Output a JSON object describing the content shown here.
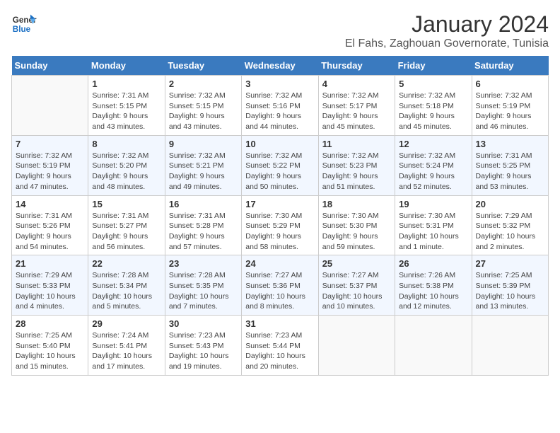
{
  "logo": {
    "text_general": "General",
    "text_blue": "Blue"
  },
  "title": "January 2024",
  "subtitle": "El Fahs, Zaghouan Governorate, Tunisia",
  "days_of_week": [
    "Sunday",
    "Monday",
    "Tuesday",
    "Wednesday",
    "Thursday",
    "Friday",
    "Saturday"
  ],
  "weeks": [
    [
      {
        "day": "",
        "sunrise": "",
        "sunset": "",
        "daylight": ""
      },
      {
        "day": "1",
        "sunrise": "Sunrise: 7:31 AM",
        "sunset": "Sunset: 5:15 PM",
        "daylight": "Daylight: 9 hours and 43 minutes."
      },
      {
        "day": "2",
        "sunrise": "Sunrise: 7:32 AM",
        "sunset": "Sunset: 5:15 PM",
        "daylight": "Daylight: 9 hours and 43 minutes."
      },
      {
        "day": "3",
        "sunrise": "Sunrise: 7:32 AM",
        "sunset": "Sunset: 5:16 PM",
        "daylight": "Daylight: 9 hours and 44 minutes."
      },
      {
        "day": "4",
        "sunrise": "Sunrise: 7:32 AM",
        "sunset": "Sunset: 5:17 PM",
        "daylight": "Daylight: 9 hours and 45 minutes."
      },
      {
        "day": "5",
        "sunrise": "Sunrise: 7:32 AM",
        "sunset": "Sunset: 5:18 PM",
        "daylight": "Daylight: 9 hours and 45 minutes."
      },
      {
        "day": "6",
        "sunrise": "Sunrise: 7:32 AM",
        "sunset": "Sunset: 5:19 PM",
        "daylight": "Daylight: 9 hours and 46 minutes."
      }
    ],
    [
      {
        "day": "7",
        "sunrise": "Sunrise: 7:32 AM",
        "sunset": "Sunset: 5:19 PM",
        "daylight": "Daylight: 9 hours and 47 minutes."
      },
      {
        "day": "8",
        "sunrise": "Sunrise: 7:32 AM",
        "sunset": "Sunset: 5:20 PM",
        "daylight": "Daylight: 9 hours and 48 minutes."
      },
      {
        "day": "9",
        "sunrise": "Sunrise: 7:32 AM",
        "sunset": "Sunset: 5:21 PM",
        "daylight": "Daylight: 9 hours and 49 minutes."
      },
      {
        "day": "10",
        "sunrise": "Sunrise: 7:32 AM",
        "sunset": "Sunset: 5:22 PM",
        "daylight": "Daylight: 9 hours and 50 minutes."
      },
      {
        "day": "11",
        "sunrise": "Sunrise: 7:32 AM",
        "sunset": "Sunset: 5:23 PM",
        "daylight": "Daylight: 9 hours and 51 minutes."
      },
      {
        "day": "12",
        "sunrise": "Sunrise: 7:32 AM",
        "sunset": "Sunset: 5:24 PM",
        "daylight": "Daylight: 9 hours and 52 minutes."
      },
      {
        "day": "13",
        "sunrise": "Sunrise: 7:31 AM",
        "sunset": "Sunset: 5:25 PM",
        "daylight": "Daylight: 9 hours and 53 minutes."
      }
    ],
    [
      {
        "day": "14",
        "sunrise": "Sunrise: 7:31 AM",
        "sunset": "Sunset: 5:26 PM",
        "daylight": "Daylight: 9 hours and 54 minutes."
      },
      {
        "day": "15",
        "sunrise": "Sunrise: 7:31 AM",
        "sunset": "Sunset: 5:27 PM",
        "daylight": "Daylight: 9 hours and 56 minutes."
      },
      {
        "day": "16",
        "sunrise": "Sunrise: 7:31 AM",
        "sunset": "Sunset: 5:28 PM",
        "daylight": "Daylight: 9 hours and 57 minutes."
      },
      {
        "day": "17",
        "sunrise": "Sunrise: 7:30 AM",
        "sunset": "Sunset: 5:29 PM",
        "daylight": "Daylight: 9 hours and 58 minutes."
      },
      {
        "day": "18",
        "sunrise": "Sunrise: 7:30 AM",
        "sunset": "Sunset: 5:30 PM",
        "daylight": "Daylight: 9 hours and 59 minutes."
      },
      {
        "day": "19",
        "sunrise": "Sunrise: 7:30 AM",
        "sunset": "Sunset: 5:31 PM",
        "daylight": "Daylight: 10 hours and 1 minute."
      },
      {
        "day": "20",
        "sunrise": "Sunrise: 7:29 AM",
        "sunset": "Sunset: 5:32 PM",
        "daylight": "Daylight: 10 hours and 2 minutes."
      }
    ],
    [
      {
        "day": "21",
        "sunrise": "Sunrise: 7:29 AM",
        "sunset": "Sunset: 5:33 PM",
        "daylight": "Daylight: 10 hours and 4 minutes."
      },
      {
        "day": "22",
        "sunrise": "Sunrise: 7:28 AM",
        "sunset": "Sunset: 5:34 PM",
        "daylight": "Daylight: 10 hours and 5 minutes."
      },
      {
        "day": "23",
        "sunrise": "Sunrise: 7:28 AM",
        "sunset": "Sunset: 5:35 PM",
        "daylight": "Daylight: 10 hours and 7 minutes."
      },
      {
        "day": "24",
        "sunrise": "Sunrise: 7:27 AM",
        "sunset": "Sunset: 5:36 PM",
        "daylight": "Daylight: 10 hours and 8 minutes."
      },
      {
        "day": "25",
        "sunrise": "Sunrise: 7:27 AM",
        "sunset": "Sunset: 5:37 PM",
        "daylight": "Daylight: 10 hours and 10 minutes."
      },
      {
        "day": "26",
        "sunrise": "Sunrise: 7:26 AM",
        "sunset": "Sunset: 5:38 PM",
        "daylight": "Daylight: 10 hours and 12 minutes."
      },
      {
        "day": "27",
        "sunrise": "Sunrise: 7:25 AM",
        "sunset": "Sunset: 5:39 PM",
        "daylight": "Daylight: 10 hours and 13 minutes."
      }
    ],
    [
      {
        "day": "28",
        "sunrise": "Sunrise: 7:25 AM",
        "sunset": "Sunset: 5:40 PM",
        "daylight": "Daylight: 10 hours and 15 minutes."
      },
      {
        "day": "29",
        "sunrise": "Sunrise: 7:24 AM",
        "sunset": "Sunset: 5:41 PM",
        "daylight": "Daylight: 10 hours and 17 minutes."
      },
      {
        "day": "30",
        "sunrise": "Sunrise: 7:23 AM",
        "sunset": "Sunset: 5:43 PM",
        "daylight": "Daylight: 10 hours and 19 minutes."
      },
      {
        "day": "31",
        "sunrise": "Sunrise: 7:23 AM",
        "sunset": "Sunset: 5:44 PM",
        "daylight": "Daylight: 10 hours and 20 minutes."
      },
      {
        "day": "",
        "sunrise": "",
        "sunset": "",
        "daylight": ""
      },
      {
        "day": "",
        "sunrise": "",
        "sunset": "",
        "daylight": ""
      },
      {
        "day": "",
        "sunrise": "",
        "sunset": "",
        "daylight": ""
      }
    ]
  ]
}
